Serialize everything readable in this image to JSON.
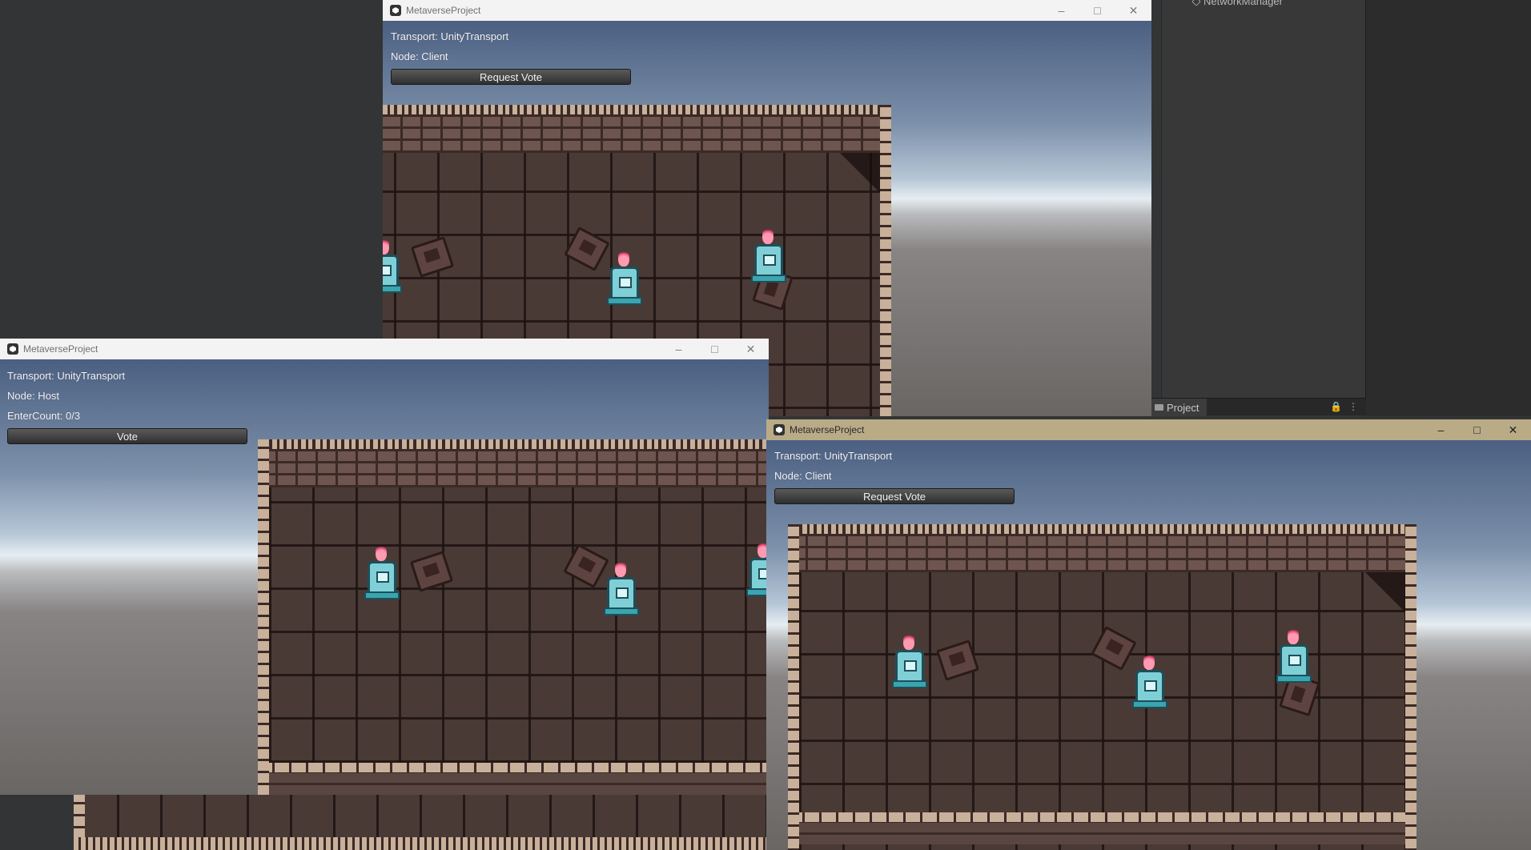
{
  "editor": {
    "hierarchy_item": "NetworkManager",
    "project_tab_label": "Project"
  },
  "windows": {
    "top": {
      "title": "MetaverseProject",
      "transport": "Transport: UnityTransport",
      "node": "Node: Client",
      "button": "Request Vote"
    },
    "left": {
      "title": "MetaverseProject",
      "transport": "Transport: UnityTransport",
      "node": "Node: Host",
      "enter_count": "EnterCount: 0/3",
      "button": "Vote"
    },
    "right": {
      "title": "MetaverseProject",
      "transport": "Transport: UnityTransport",
      "node": "Node: Client",
      "button": "Request Vote"
    }
  },
  "window_controls": {
    "minimize": "–",
    "maximize": "□",
    "close": "✕"
  },
  "colors": {
    "titlebar_inactive": "#f3f3f3",
    "titlebar_active": "#b8ab86",
    "editor_bg": "#333436",
    "button_bg": "#3a3a3a"
  }
}
